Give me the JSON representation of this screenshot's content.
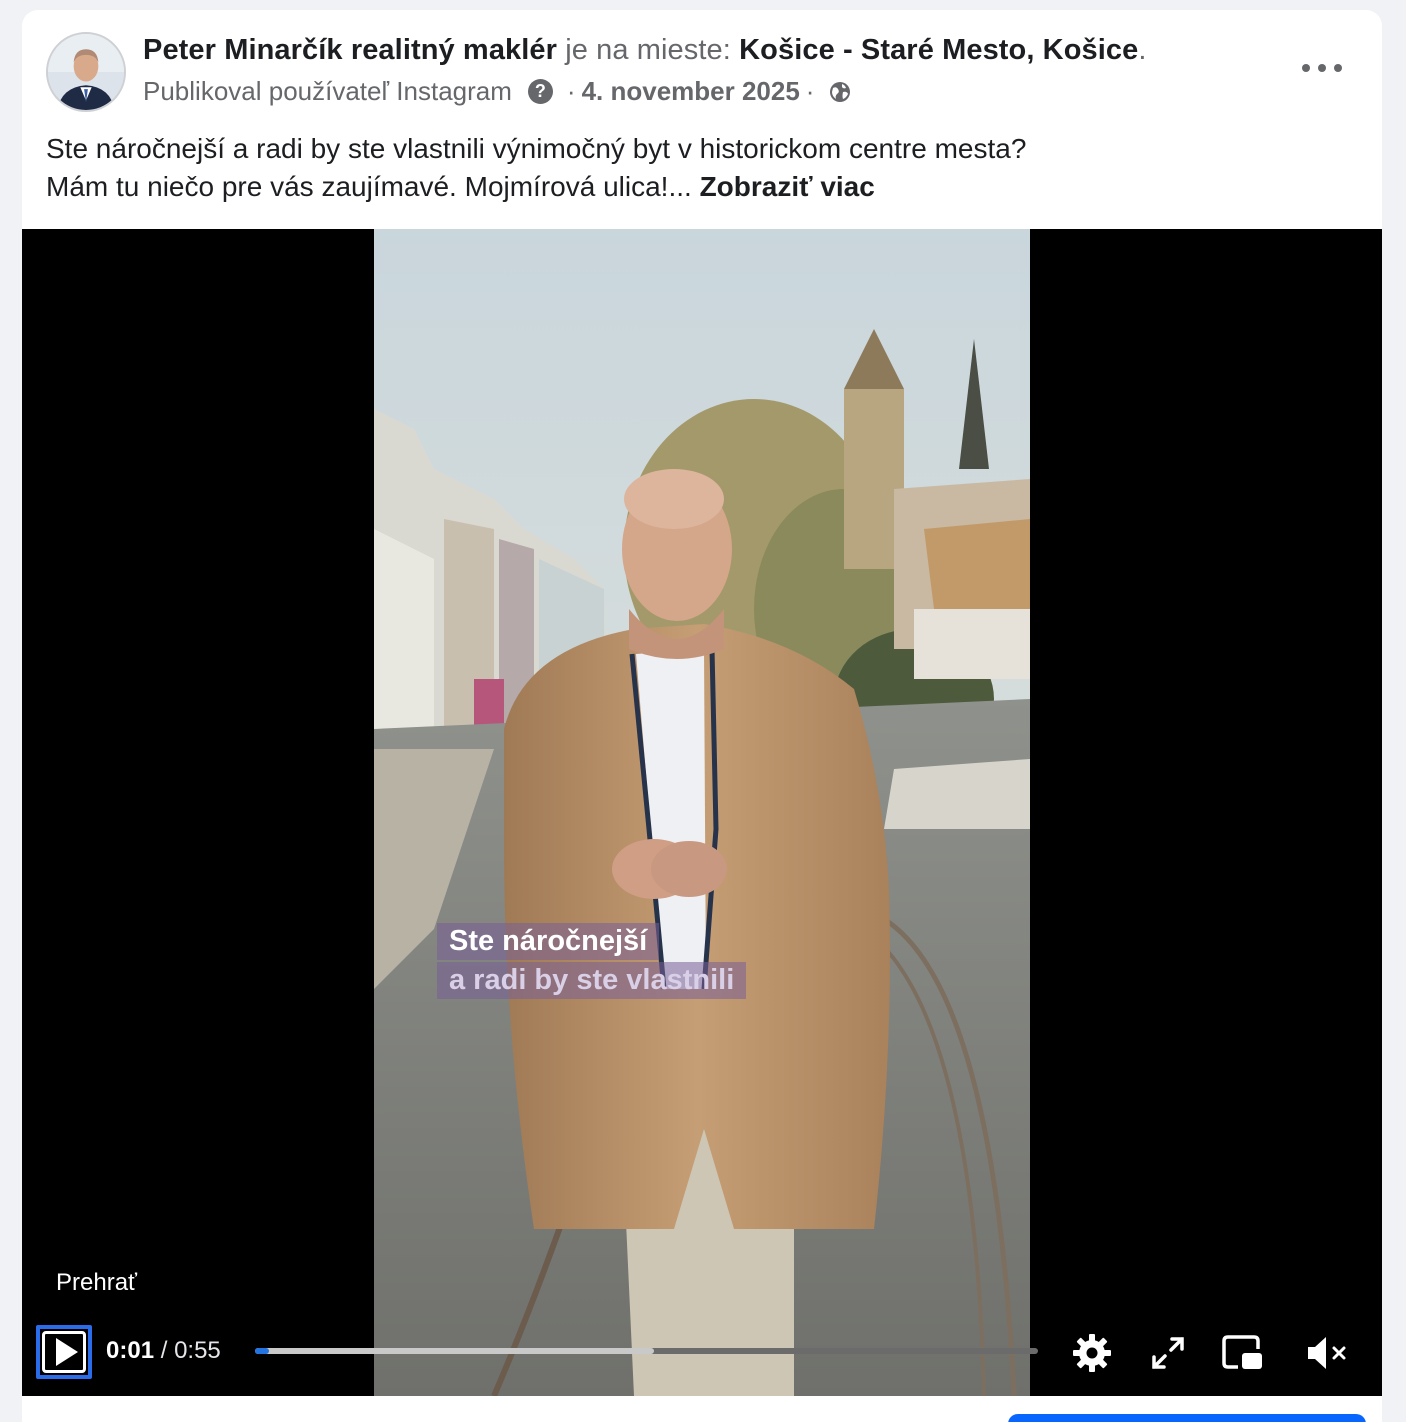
{
  "post": {
    "author": "Peter Minarčík realitný maklér",
    "location_prefix": "je na mieste:",
    "location": "Košice - Staré Mesto, Košice",
    "location_suffix": ".",
    "source": "Publikoval používateľ Instagram",
    "date": "4. november 2025",
    "text_line1": "Ste náročnejší a radi by ste vlastnili výnimočný byt v historickom centre mesta?",
    "text_line2": "Mám tu niečo pre vás zaujímavé. Mojmírová ulica!...",
    "see_more": "Zobraziť viac"
  },
  "video": {
    "caption_line1": "Ste náročnejší",
    "caption_line2": "a radi by ste vlastnili",
    "play_label": "Prehrať",
    "current_time": "0:01",
    "time_separator": "/",
    "total_time": "0:55",
    "played_fraction": 0.018,
    "buffered_fraction": 0.51
  },
  "icons": {
    "more": "more-icon",
    "help": "help-icon",
    "globe": "globe-icon",
    "play": "play-icon",
    "settings": "gear-icon",
    "fullscreen": "expand-icon",
    "pip": "picture-in-picture-icon",
    "volume": "muted-volume-icon"
  },
  "colors": {
    "progress_played": "#2374e1",
    "focus_outline": "#2b6cea",
    "caption_bg": "#785f96"
  }
}
